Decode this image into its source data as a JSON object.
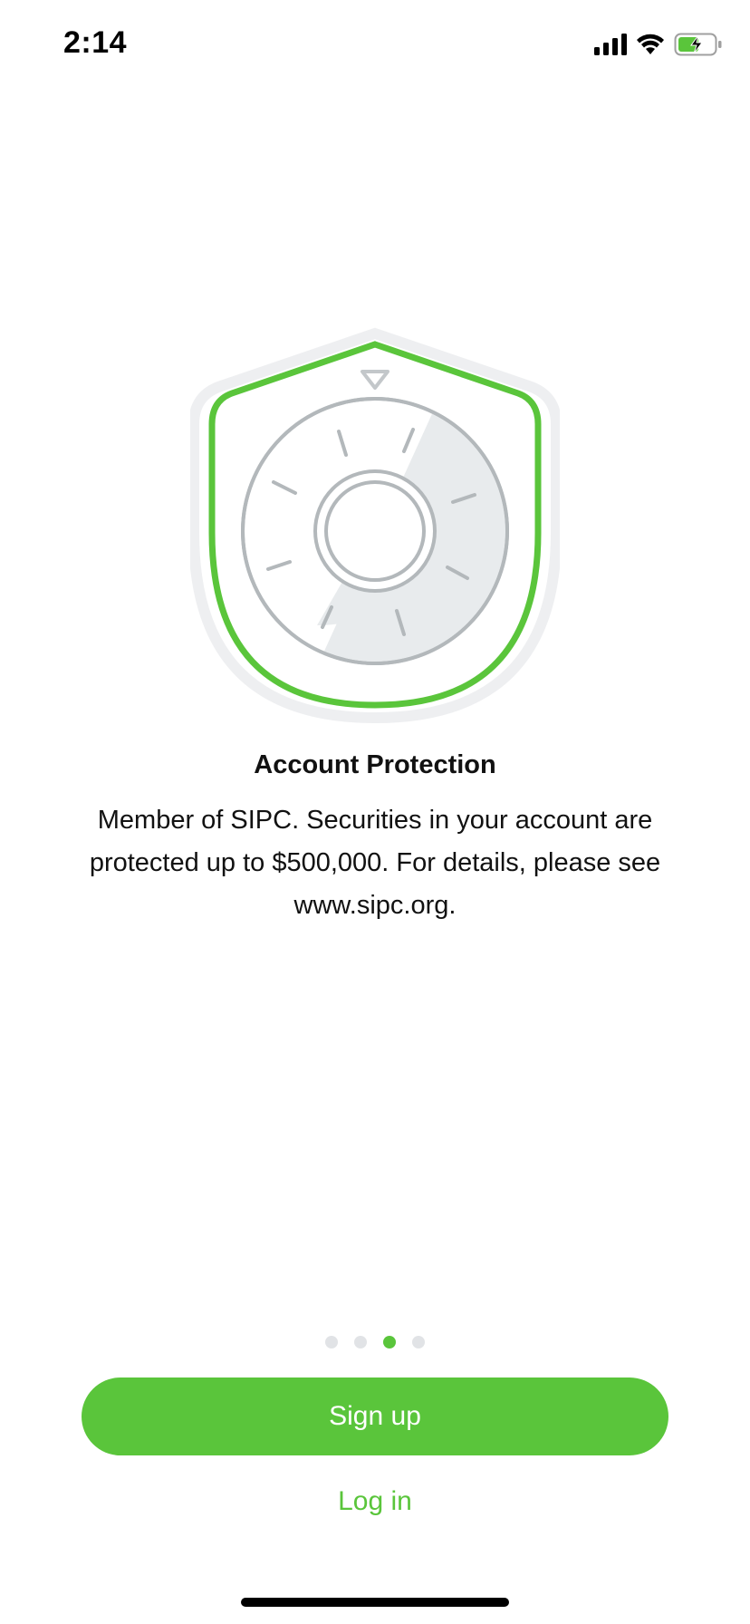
{
  "status_bar": {
    "time": "2:14",
    "icons": [
      "signal-icon",
      "wifi-icon",
      "battery-charging-icon"
    ]
  },
  "onboarding": {
    "illustration": "shield-safe-dial-icon",
    "title": "Account Protection",
    "body": "Member of SIPC. Securities in your account are protected up to $500,000. For details, please see www.sipc.org.",
    "pager": {
      "total": 4,
      "active_index": 2
    }
  },
  "actions": {
    "signup_label": "Sign up",
    "login_label": "Log in"
  },
  "colors": {
    "accent": "#5ac53b",
    "dot_inactive": "#e1e3e6",
    "dial_gray": "#b3b8bb",
    "dial_fill": "#e8ebed"
  }
}
